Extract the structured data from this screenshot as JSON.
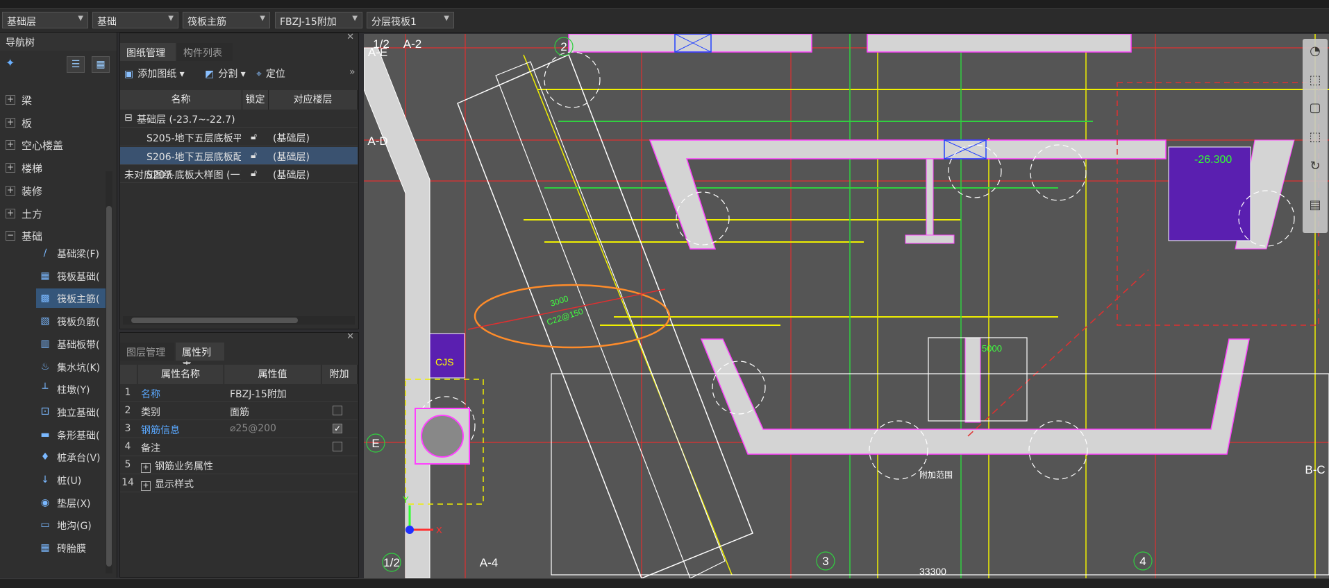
{
  "toolbar": {
    "floor": "基础层",
    "category": "基础",
    "component_type": "筏板主筋",
    "component": "FBZJ-15附加",
    "layer": "分层筏板1"
  },
  "nav": {
    "title": "导航树",
    "items": [
      {
        "label": "梁"
      },
      {
        "label": "板"
      },
      {
        "label": "空心楼盖"
      },
      {
        "label": "楼梯"
      },
      {
        "label": "装修"
      },
      {
        "label": "土方"
      },
      {
        "label": "基础"
      }
    ],
    "sub_items": [
      {
        "label": "基础梁(F)",
        "icon": "beam-icon"
      },
      {
        "label": "筏板基础(",
        "icon": "raft-icon"
      },
      {
        "label": "筏板主筋(",
        "icon": "rebar-icon"
      },
      {
        "label": "筏板负筋(",
        "icon": "neg-rebar-icon"
      },
      {
        "label": "基础板带(",
        "icon": "strip-icon"
      },
      {
        "label": "集水坑(K)",
        "icon": "sump-icon"
      },
      {
        "label": "柱墩(Y)",
        "icon": "pier-icon"
      },
      {
        "label": "独立基础(",
        "icon": "footing-icon"
      },
      {
        "label": "条形基础(",
        "icon": "strip-footing-icon"
      },
      {
        "label": "桩承台(V)",
        "icon": "pile-cap-icon"
      },
      {
        "label": "桩(U)",
        "icon": "pile-icon"
      },
      {
        "label": "垫层(X)",
        "icon": "cushion-icon"
      },
      {
        "label": "地沟(G)",
        "icon": "trench-icon"
      },
      {
        "label": "砖胎膜",
        "icon": "brick-icon"
      }
    ]
  },
  "drawing_panel": {
    "tabs": [
      "图纸管理",
      "构件列表"
    ],
    "actions": {
      "add": "添加图纸",
      "split": "分割",
      "locate": "定位"
    },
    "columns": [
      "名称",
      "锁定",
      "对应楼层"
    ],
    "group": "基础层 (-23.7~-22.7)",
    "rows": [
      {
        "name": "S205-地下五层底板平...",
        "floor": "(基础层)"
      },
      {
        "name": "S206-地下五层底板配...",
        "floor": "(基础层)"
      },
      {
        "name": "S207-底板大样图 (一)",
        "floor": "(基础层)"
      }
    ],
    "unmatched": "未对应图纸"
  },
  "property_panel": {
    "tabs": [
      "图层管理",
      "属性列表"
    ],
    "columns": [
      "属性名称",
      "属性值",
      "附加"
    ],
    "rows": [
      {
        "n": "1",
        "name": "名称",
        "value": "FBZJ-15附加"
      },
      {
        "n": "2",
        "name": "类别",
        "value": "面筋"
      },
      {
        "n": "3",
        "name": "钢筋信息",
        "value": "⌀25@200"
      },
      {
        "n": "4",
        "name": "备注",
        "value": ""
      },
      {
        "n": "5",
        "name": "钢筋业务属性",
        "value": ""
      },
      {
        "n": "14",
        "name": "显示样式",
        "value": ""
      }
    ]
  },
  "canvas": {
    "axis_labels": [
      "1/2",
      "A-2",
      "2",
      "A-E",
      "A-D",
      "E",
      "3",
      "4",
      "1/2",
      "A-4",
      "B-C"
    ],
    "elevation": "-26.300",
    "dimension": "33300",
    "cjs_label": "CJS",
    "rebar_text_1": "3000",
    "rebar_text_2": "C22@150",
    "rebar_text_3": "5000",
    "annotation": "附加范围",
    "colors": {
      "background": "#555555",
      "red_axis": "#e03030",
      "yellow": "#f0f000",
      "magenta": "#ff40ff",
      "purple": "#5a1fb0",
      "orange": "#ff8c2a",
      "green": "#30d040"
    }
  }
}
